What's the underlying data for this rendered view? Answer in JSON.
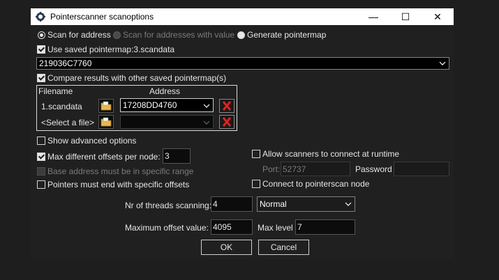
{
  "window": {
    "title": "Pointerscanner scanoptions",
    "minimize": "—",
    "maximize": "☐",
    "close": "✕"
  },
  "scan_mode": {
    "options": [
      "Scan for address",
      "Scan for addresses with value",
      "Generate pointermap"
    ],
    "selected": "Scan for address"
  },
  "saved_pointermap": {
    "label": "Use saved pointermap:3.scandata",
    "checked": true,
    "address_value": "219036C7760"
  },
  "compare": {
    "label": "Compare results with other saved pointermap(s)",
    "checked": true,
    "headers": {
      "filename": "Filename",
      "address": "Address"
    },
    "rows": [
      {
        "filename": "1.scandata",
        "address": "17208DD4760"
      },
      {
        "filename": "<Select a file>",
        "address": ""
      }
    ]
  },
  "advanced": {
    "show_advanced_label": "Show advanced options",
    "max_offsets_label": "Max different offsets per node:",
    "max_offsets_value": "3",
    "base_range_label": "Base address must be in specific range",
    "pointers_end_label": "Pointers must end with specific offsets"
  },
  "network": {
    "allow_label": "Allow scanners to connect at runtime",
    "port_label": "Port:",
    "port_value": "52737",
    "password_label": "Password",
    "password_value": "",
    "connect_label": "Connect to pointerscan node"
  },
  "threads": {
    "label": "Nr of threads scanning:",
    "value": "4",
    "priority": "Normal"
  },
  "offsets": {
    "max_offset_label": "Maximum offset value:",
    "max_offset_value": "4095",
    "max_level_label": "Max level",
    "max_level_value": "7"
  },
  "buttons": {
    "ok": "OK",
    "cancel": "Cancel"
  },
  "colors": {
    "background": "#202020",
    "titlebar": "#ffffff",
    "delete_x": "#e02020",
    "folder": "#e8b84a"
  }
}
